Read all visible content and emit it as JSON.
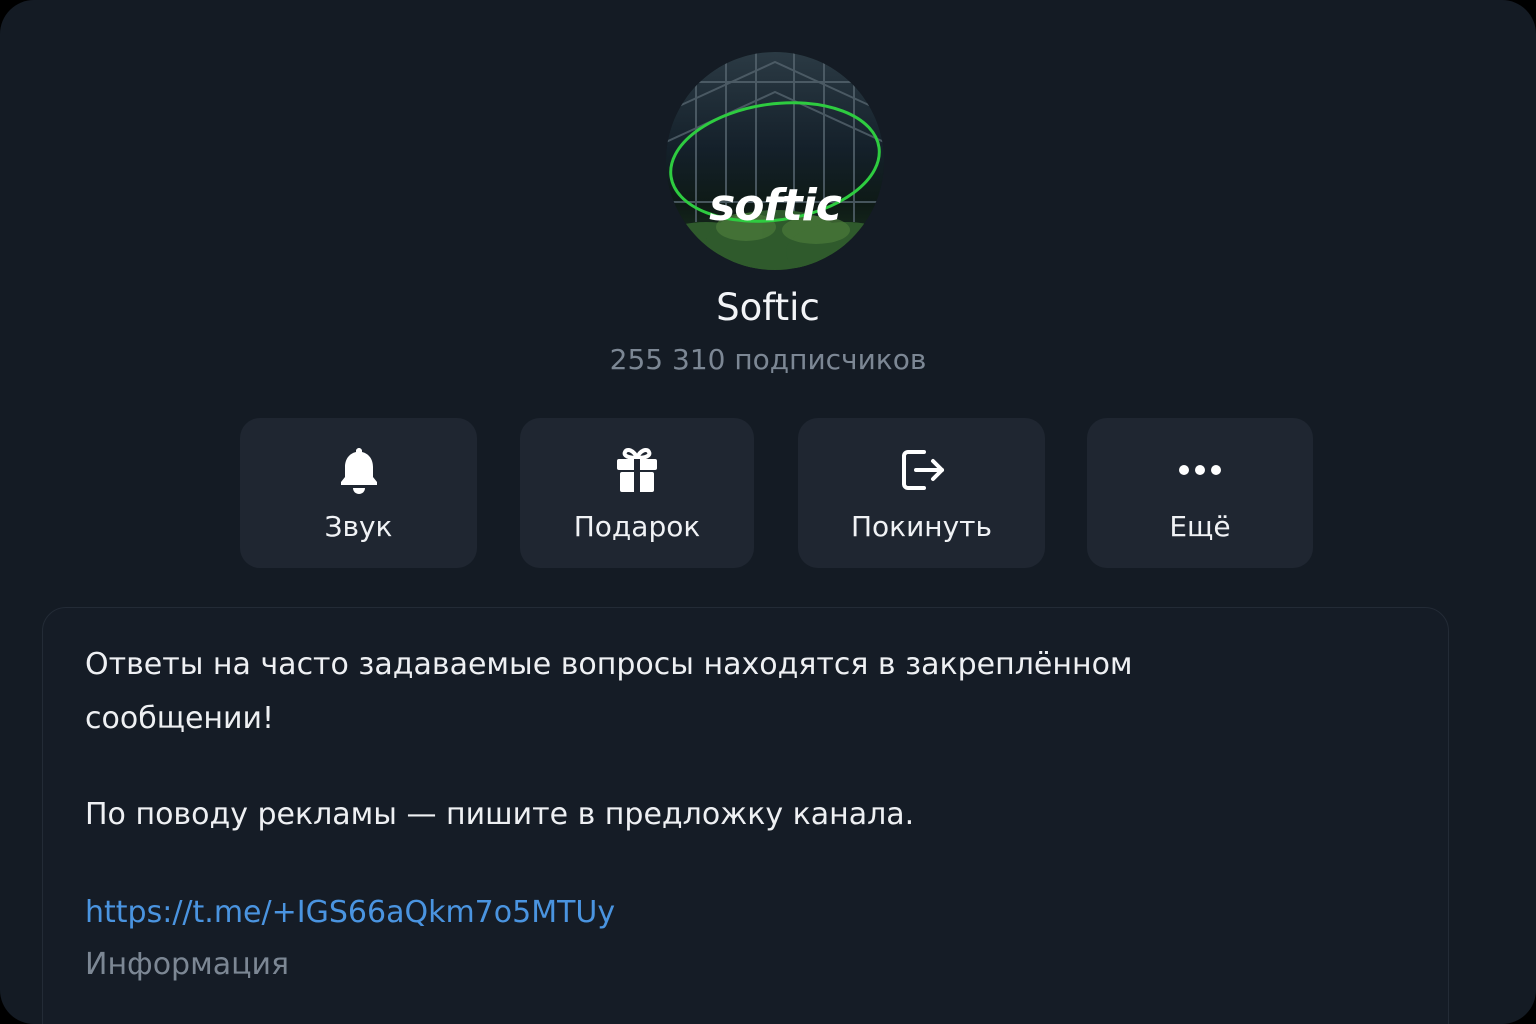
{
  "channel": {
    "avatar_text": "softic",
    "name": "Softic",
    "subscribers": "255 310 подписчиков"
  },
  "actions": [
    {
      "label": "Звук",
      "icon": "bell-icon"
    },
    {
      "label": "Подарок",
      "icon": "gift-icon"
    },
    {
      "label": "Покинуть",
      "icon": "leave-icon"
    },
    {
      "label": "Ещё",
      "icon": "more-icon"
    }
  ],
  "info": {
    "description_line1": "Ответы на часто задаваемые вопросы находятся в закреплённом сообщении!",
    "description_line2": "По поводу рекламы — пишите в предложку канала.",
    "link": "https://t.me/+IGS66aQkm7o5MTUy",
    "label": "Информация"
  },
  "colors": {
    "background": "#141b24",
    "button": "#1f2631",
    "link": "#4a94e0",
    "muted": "#7c8794",
    "avatar_ring": "#2ecc40"
  }
}
